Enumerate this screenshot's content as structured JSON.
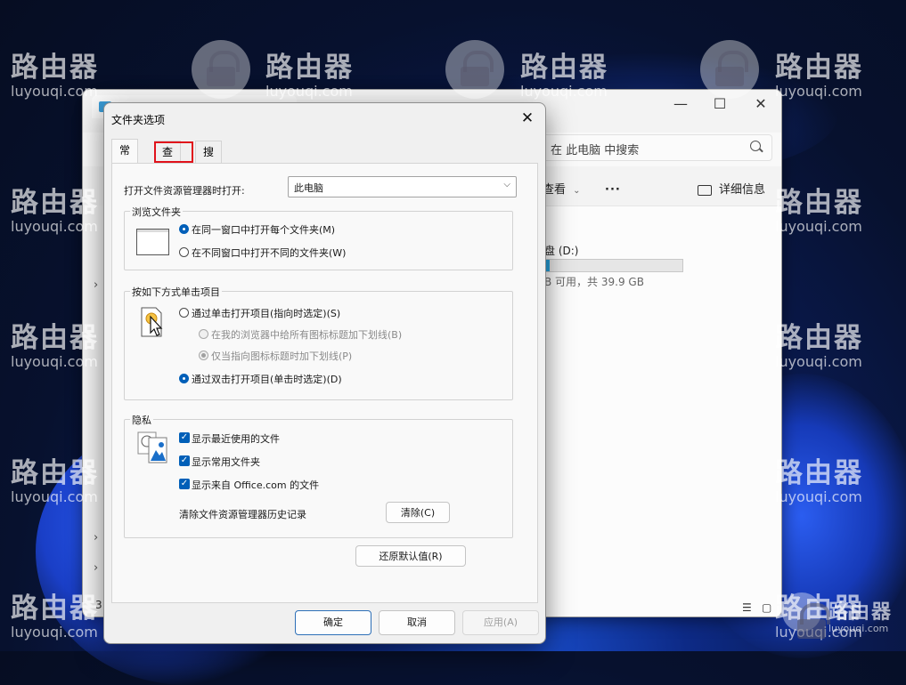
{
  "watermark": {
    "brand": "路由器",
    "domain": "luyouqi.com"
  },
  "explorer": {
    "search_placeholder": "在 此电脑 中搜索",
    "view_label": "查看",
    "more_label": "···",
    "details_label": "详细信息",
    "drive_name": "盘 (D:)",
    "drive_free_text": "B 可用，共 39.9 GB",
    "status_count": "3",
    "minimize_glyph": "—",
    "maximize_glyph": "☐",
    "close_glyph": "✕",
    "chevron_glyph": "›",
    "view_chevron": "⌄",
    "drive_used_fraction": 0.03
  },
  "dialog": {
    "title": "文件夹选项",
    "close_glyph": "✕",
    "tabs": [
      "常规",
      "查看",
      "搜索"
    ],
    "open_explorer_label": "打开文件资源管理器时打开:",
    "open_explorer_value": "此电脑",
    "combo_arrow": "⌵",
    "browse_group": {
      "title": "浏览文件夹",
      "opt_same": "在同一窗口中打开每个文件夹(M)",
      "opt_new": "在不同窗口中打开不同的文件夹(W)"
    },
    "click_group": {
      "title": "按如下方式单击项目",
      "opt_single": "通过单击打开项目(指向时选定)(S)",
      "opt_underline_all": "在我的浏览器中给所有图标标题加下划线(B)",
      "opt_underline_point": "仅当指向图标标题时加下划线(P)",
      "opt_double": "通过双击打开项目(单击时选定)(D)"
    },
    "privacy_group": {
      "title": "隐私",
      "show_recent": "显示最近使用的文件",
      "show_frequent": "显示常用文件夹",
      "show_office": "显示来自 Office.com 的文件",
      "clear_label": "清除文件资源管理器历史记录",
      "clear_button": "清除(C)",
      "check_glyph": "✓"
    },
    "restore_button": "还原默认值(R)",
    "ok_button": "确定",
    "cancel_button": "取消",
    "apply_button": "应用(A)"
  }
}
